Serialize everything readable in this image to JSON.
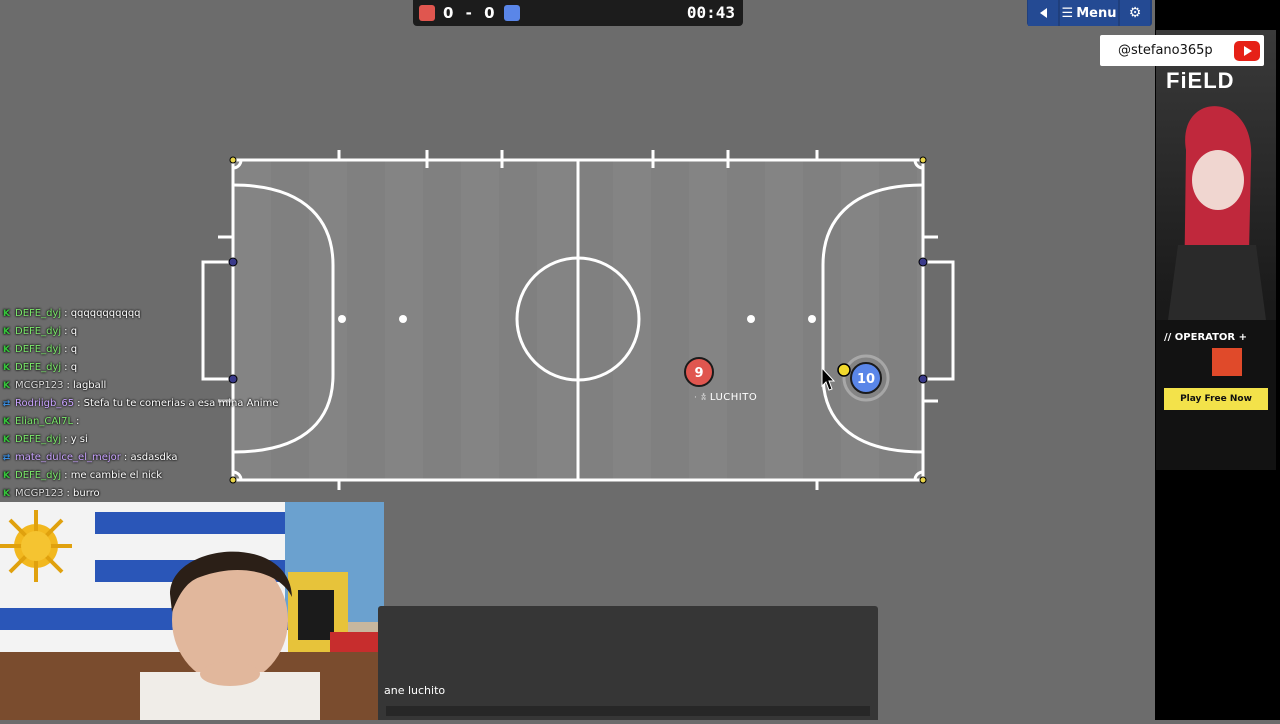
{
  "hud": {
    "score_red": "0",
    "score_separator": "-",
    "score_blue": "0",
    "timer": "00:43",
    "red_color": "#e0564f",
    "blue_color": "#5a86e8",
    "menu_label": "Menu",
    "back_icon": "back-arrow-icon",
    "menu_icon": "hamburger-icon",
    "settings_icon": "gear-icon"
  },
  "field": {
    "red_player_number": "9",
    "blue_player_number": "10",
    "red_player_name": "LUCHITO",
    "red_player_prefix": "· 𖠋",
    "field_color": "#8a8a8a",
    "line_color": "#ffffff"
  },
  "chat": [
    {
      "badge": "K",
      "badge_color": "#35c43a",
      "name": "DEFE_dyj",
      "name_color": "#7be86b",
      "text": ": qqqqqqqqqqq"
    },
    {
      "badge": "K",
      "badge_color": "#35c43a",
      "name": "DEFE_dyj",
      "name_color": "#7be86b",
      "text": ": q"
    },
    {
      "badge": "K",
      "badge_color": "#35c43a",
      "name": "DEFE_dyj",
      "name_color": "#7be86b",
      "text": ": q"
    },
    {
      "badge": "K",
      "badge_color": "#35c43a",
      "name": "DEFE_dyj",
      "name_color": "#7be86b",
      "text": ": q"
    },
    {
      "badge": "K",
      "badge_color": "#35c43a",
      "name": "MCGP123",
      "name_color": "#dddddd",
      "text": ": lagball"
    },
    {
      "badge": "⇄",
      "badge_color": "#3a8de0",
      "name": "Rodriigb_65",
      "name_color": "#c9a3ff",
      "text": ": Stefa tu te comerias a esa mina Anime"
    },
    {
      "badge": "K",
      "badge_color": "#35c43a",
      "name": "Elian_CAI7L",
      "name_color": "#7be86b",
      "text": ": "
    },
    {
      "badge": "K",
      "badge_color": "#35c43a",
      "name": "DEFE_dyj",
      "name_color": "#7be86b",
      "text": ": y si"
    },
    {
      "badge": "⇄",
      "badge_color": "#3a8de0",
      "name": "mate_dulce_el_mejor",
      "name_color": "#c9a3ff",
      "text": ": asdasdka"
    },
    {
      "badge": "K",
      "badge_color": "#35c43a",
      "name": "DEFE_dyj",
      "name_color": "#7be86b",
      "text": ": me cambie el nick"
    },
    {
      "badge": "K",
      "badge_color": "#35c43a",
      "name": "MCGP123",
      "name_color": "#dddddd",
      "text": ": burro"
    }
  ],
  "console": {
    "text": "ane luchito"
  },
  "overlay": {
    "handle": "@stefano365p"
  },
  "ad": {
    "title": "FiELD",
    "operator": "// OPERATOR +",
    "play": "Play Free Now"
  }
}
